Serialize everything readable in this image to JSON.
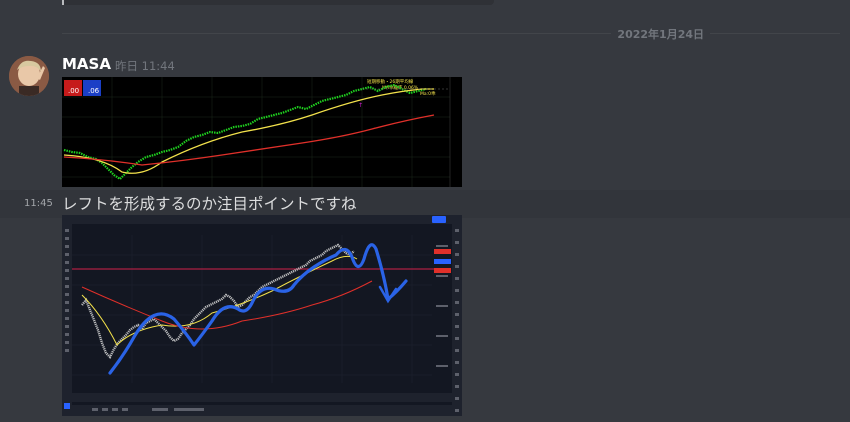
{
  "date_divider": "2022年1月24日",
  "messages": [
    {
      "username": "MASA",
      "timestamp": "昨日 11:44",
      "attachment": "chart-screenshot"
    },
    {
      "hover_time": "11:45",
      "text": "レフトを形成するのか注目ポイントですね",
      "attachment": "tradingview-chart-screenshot"
    }
  ],
  "chart1": {
    "price_left_sell": ".00",
    "price_left_buy": ".06",
    "overlay_line1": "短期移動・26期平均線",
    "overlay_line2": "MA乖離率 0.06%",
    "overlay_line3": "Ma:0乖"
  },
  "colors": {
    "background": "#36393f",
    "username": "#ffffff",
    "text": "#dcddde",
    "muted": "#72767d",
    "ma_yellow": "#f2e14b",
    "ma_red": "#e0302a",
    "arrow_blue": "#2a63e6",
    "tv_bg": "#131722"
  }
}
